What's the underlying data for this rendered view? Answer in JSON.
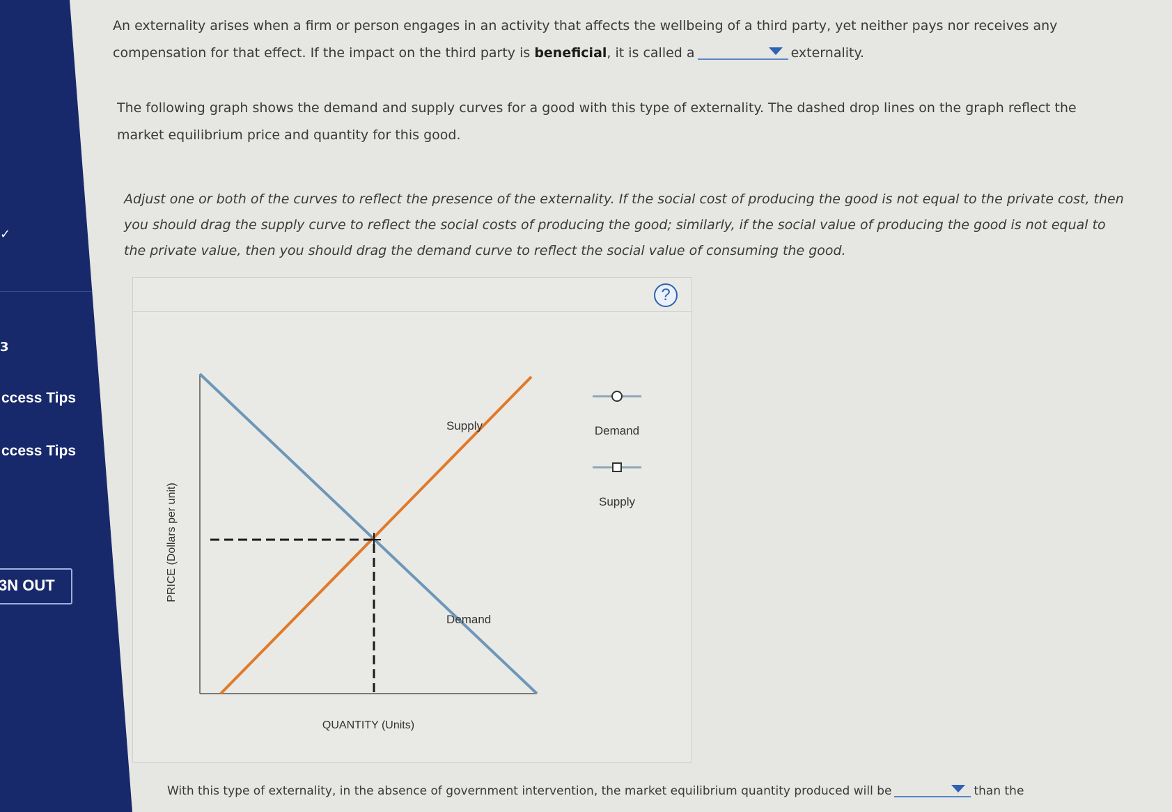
{
  "sidebar": {
    "mark_top": "✓",
    "mark_mid": "3",
    "link1": "ccess Tips",
    "link2": "ccess Tips",
    "signout": "3N OUT"
  },
  "question": {
    "p1_line1": "An externality arises when a firm or person engages in an activity that affects the wellbeing of a third party, yet neither pays nor receives any",
    "p1_line2_before": "compensation for that effect. If the impact on the third party is ",
    "p1_bold": "beneficial",
    "p1_line2_mid": ", it is called a",
    "p1_line2_after": "externality.",
    "p2_line1": "The following graph shows the demand and supply curves for a good with this type of externality. The dashed drop lines on the graph reflect the",
    "p2_line2": "market equilibrium price and quantity for this good.",
    "p3_line1": "Adjust one or both of the curves to reflect the presence of the externality. If the social cost of producing the good is not equal to the private cost, then",
    "p3_line2": "you should drag the supply curve to reflect the social costs of producing the good; similarly, if the social value of producing the good is not equal to",
    "p3_line3": "the private value, then you should drag the demand curve to reflect the social value of consuming the good.",
    "bottom_before": "With this type of externality, in the absence of government intervention, the market equilibrium quantity produced will be",
    "bottom_after": "than the"
  },
  "graph": {
    "help": "?",
    "ylabel": "PRICE (Dollars per unit)",
    "xlabel": "QUANTITY (Units)",
    "supply_label": "Supply",
    "demand_label": "Demand",
    "legend_demand": "Demand",
    "legend_supply": "Supply",
    "colors": {
      "demand": "#6d97b8",
      "supply": "#e07a2a",
      "dashed": "#1a1a1a"
    }
  }
}
